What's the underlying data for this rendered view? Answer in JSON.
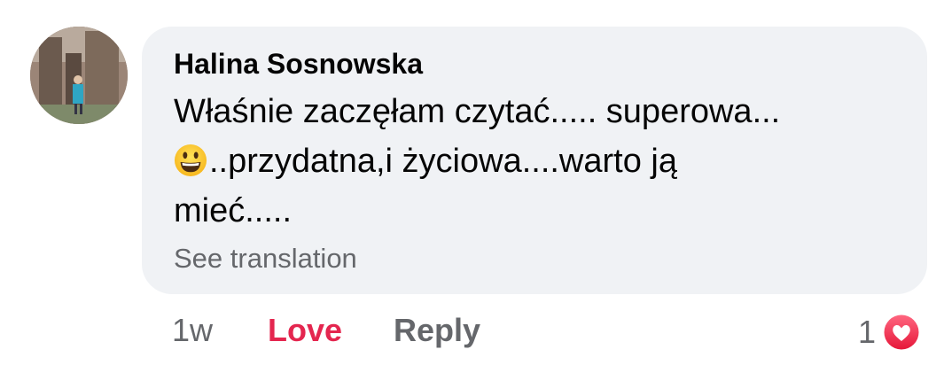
{
  "comment": {
    "author": "Halina Sosnowska",
    "text_lines": [
      "Właśnie zaczęłam czytać..... superowa...",
      "..przydatna,i życiowa....warto ją",
      "mieć....."
    ],
    "emoji_name": "grinning-face-emoji",
    "see_translation": "See translation"
  },
  "actions": {
    "time": "1w",
    "love_label": "Love",
    "reply_label": "Reply",
    "reaction_count": "1",
    "reaction_icon": "heart-reaction-icon"
  },
  "colors": {
    "bubble_bg": "#f0f2f5",
    "love_red": "#e4264f",
    "secondary_text": "#65676b"
  }
}
